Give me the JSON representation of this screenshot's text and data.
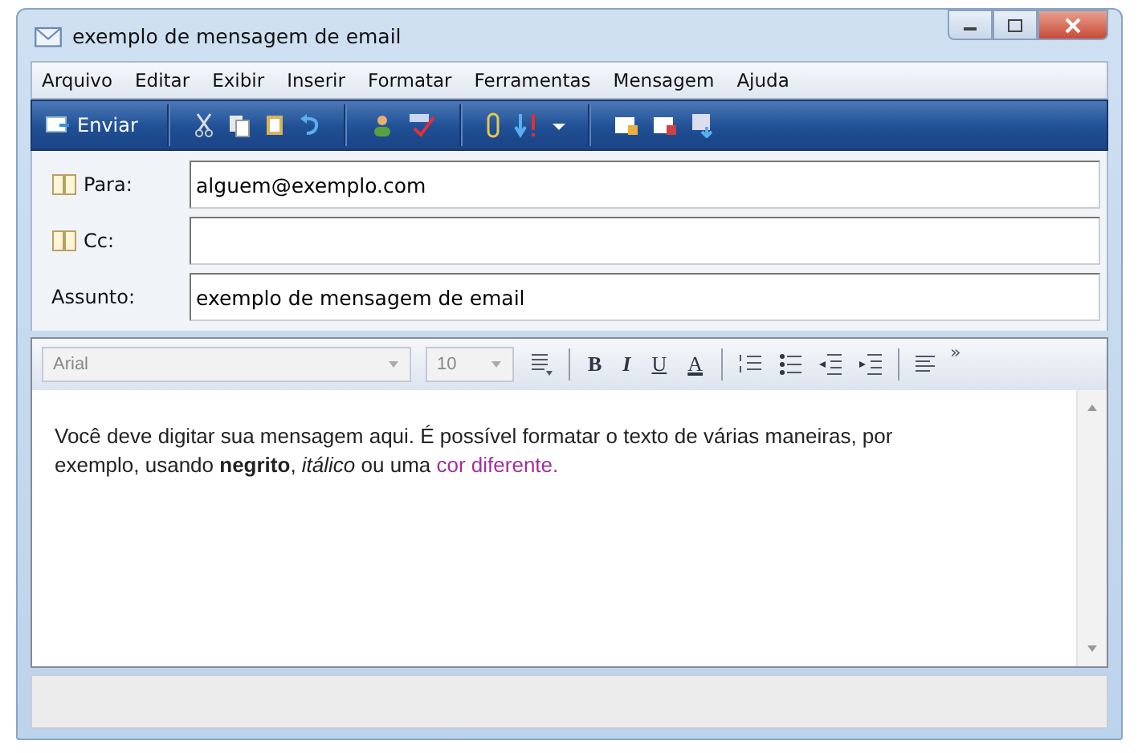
{
  "window": {
    "title": "exemplo de mensagem de email"
  },
  "menu": [
    {
      "label": "Arquivo"
    },
    {
      "label": "Editar"
    },
    {
      "label": "Exibir"
    },
    {
      "label": "Inserir"
    },
    {
      "label": "Formatar"
    },
    {
      "label": "Ferramentas"
    },
    {
      "label": "Mensagem"
    },
    {
      "label": "Ajuda"
    }
  ],
  "toolbar": {
    "send": "Enviar"
  },
  "fields": [
    {
      "label": "Para:",
      "value": "alguem@exemplo.com",
      "kind": "recipient"
    },
    {
      "label": "Cc:",
      "kind": "recipient"
    },
    {
      "label": "Assunto:",
      "value": "exemplo de mensagem de email",
      "kind": "subject"
    }
  ],
  "format_bar": {
    "font": "Arial",
    "size": "10",
    "bold": "B",
    "italic": "I",
    "underline": "U",
    "font_color_letter": "A",
    "more": "»"
  },
  "body": [
    {
      "text": "Você deve digitar sua mensagem aqui. É possível formatar o texto de várias maneiras, por exemplo, usando **negrito**, *itálico* ou uma ",
      "kind": "plain"
    },
    {
      "text": "cor diferente.",
      "kind": "colored",
      "color": "#a0309c"
    }
  ]
}
